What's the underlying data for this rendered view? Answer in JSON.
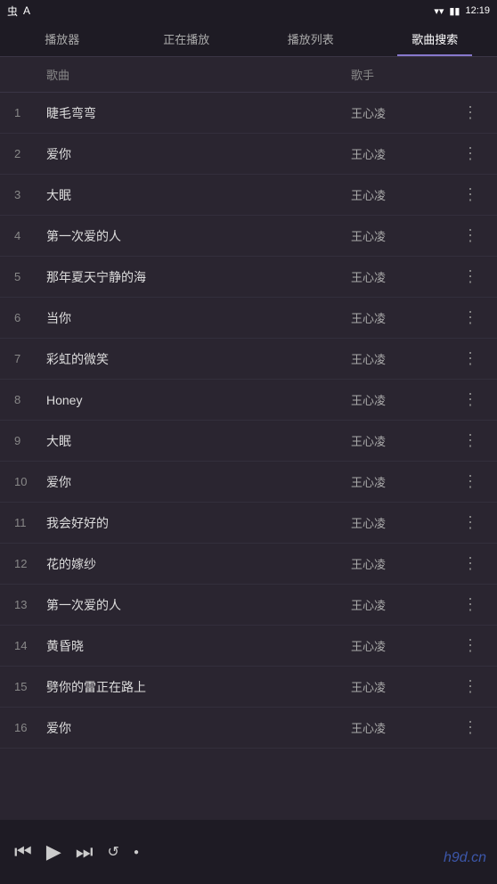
{
  "statusBar": {
    "leftIcons": [
      "虫",
      "A"
    ],
    "rightIcons": [
      "▾",
      "📶",
      "🔋"
    ],
    "time": "12:19"
  },
  "tabs": [
    {
      "id": "player",
      "label": "播放器"
    },
    {
      "id": "nowplaying",
      "label": "正在播放"
    },
    {
      "id": "playlist",
      "label": "播放列表"
    },
    {
      "id": "search",
      "label": "歌曲搜索"
    }
  ],
  "activeTab": "search",
  "columns": {
    "song": "歌曲",
    "artist": "歌手"
  },
  "songs": [
    {
      "num": 1,
      "title": "睫毛弯弯",
      "artist": "王心凌"
    },
    {
      "num": 2,
      "title": "爱你",
      "artist": "王心凌"
    },
    {
      "num": 3,
      "title": "大眠",
      "artist": "王心凌"
    },
    {
      "num": 4,
      "title": "第一次爱的人",
      "artist": "王心凌"
    },
    {
      "num": 5,
      "title": "那年夏天宁静的海",
      "artist": "王心凌"
    },
    {
      "num": 6,
      "title": "当你",
      "artist": "王心凌"
    },
    {
      "num": 7,
      "title": "彩虹的微笑",
      "artist": "王心凌"
    },
    {
      "num": 8,
      "title": "Honey",
      "artist": "王心凌"
    },
    {
      "num": 9,
      "title": "大眠",
      "artist": "王心凌"
    },
    {
      "num": 10,
      "title": "爱你",
      "artist": "王心凌"
    },
    {
      "num": 11,
      "title": "我会好好的",
      "artist": "王心凌"
    },
    {
      "num": 12,
      "title": "花的嫁纱",
      "artist": "王心凌"
    },
    {
      "num": 13,
      "title": "第一次爱的人",
      "artist": "王心凌"
    },
    {
      "num": 14,
      "title": "黄昏晓",
      "artist": "王心凌"
    },
    {
      "num": 15,
      "title": "劈你的雷正在路上",
      "artist": "王心凌"
    },
    {
      "num": 16,
      "title": "爱你",
      "artist": "王心凌"
    }
  ],
  "player": {
    "prevIcon": "⏮",
    "playIcon": "▶",
    "nextIcon": "⏭",
    "repeatIcon": "🔁",
    "dot": "●"
  },
  "watermark": "h9d.cn"
}
